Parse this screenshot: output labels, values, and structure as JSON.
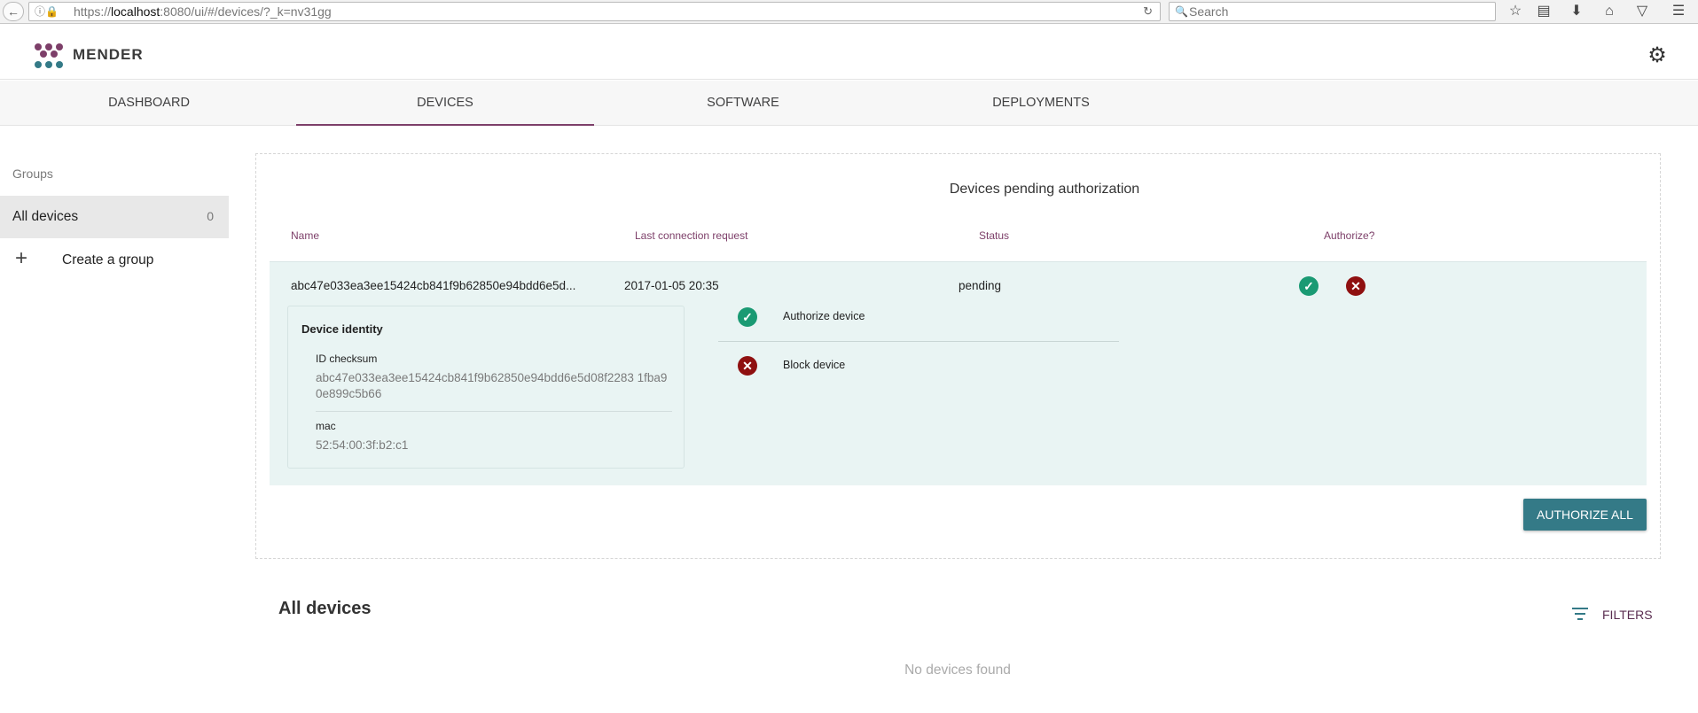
{
  "browser": {
    "url_prefix": "https://",
    "url_host": "localhost",
    "url_rest": ":8080/ui/#/devices/?_k=nv31gg",
    "search_placeholder": "Search"
  },
  "header": {
    "logo_text": "MENDER"
  },
  "tabs": [
    {
      "label": "DASHBOARD"
    },
    {
      "label": "DEVICES"
    },
    {
      "label": "SOFTWARE"
    },
    {
      "label": "DEPLOYMENTS"
    }
  ],
  "sidebar": {
    "groups_label": "Groups",
    "all_devices": {
      "label": "All devices",
      "count": "0"
    },
    "create_group_label": "Create a group"
  },
  "pending": {
    "title": "Devices pending authorization",
    "columns": {
      "name": "Name",
      "last_connection": "Last connection request",
      "status": "Status",
      "authorize": "Authorize?"
    },
    "row": {
      "name": "abc47e033ea3ee15424cb841f9b62850e94bdd6e5d...",
      "last_connection": "2017-01-05 20:35",
      "status": "pending"
    },
    "identity": {
      "title": "Device identity",
      "attributes": [
        {
          "name": "ID checksum",
          "value": "abc47e033ea3ee15424cb841f9b62850e94bdd6e5d08f2283 1fba90e899c5b66"
        },
        {
          "name": "mac",
          "value": "52:54:00:3f:b2:c1"
        }
      ]
    },
    "actions": {
      "authorize": "Authorize device",
      "block": "Block device"
    },
    "authorize_all_label": "AUTHORIZE ALL"
  },
  "all_devices": {
    "title": "All devices",
    "filters_label": "FILTERS",
    "empty_text": "No devices found"
  },
  "colors": {
    "accent": "#7d3f69",
    "button": "#347a87",
    "ok": "#1a9a73",
    "reject": "#8f1010"
  }
}
